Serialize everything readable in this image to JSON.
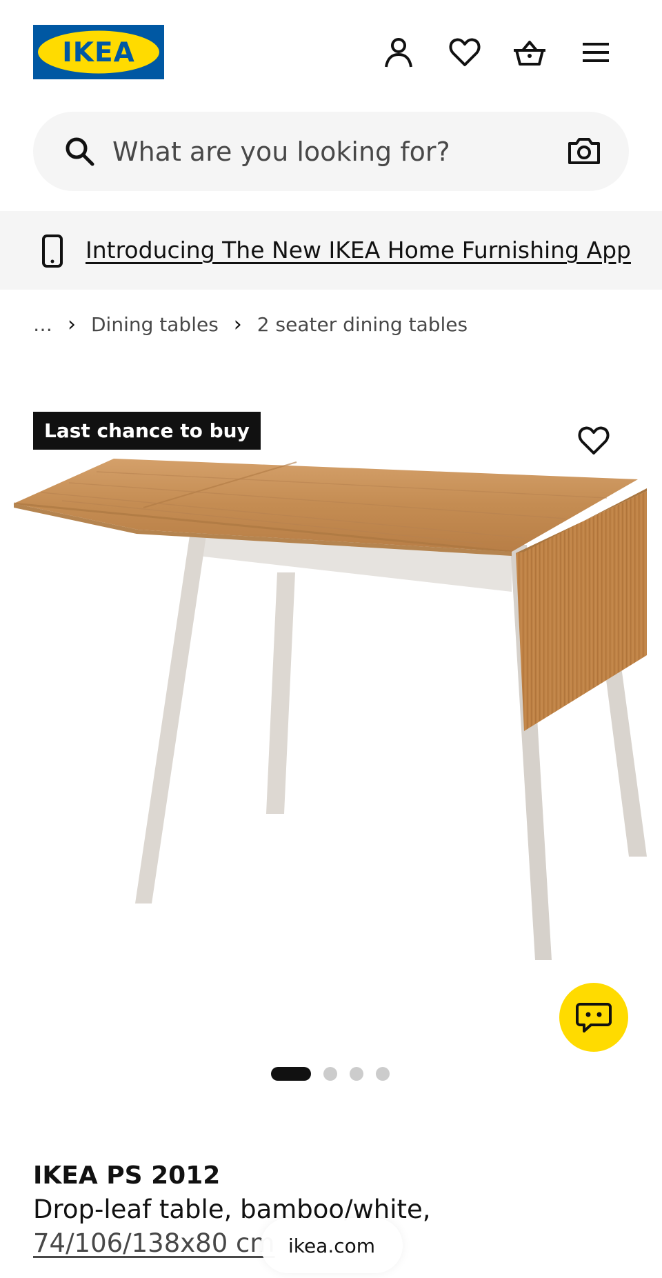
{
  "header": {
    "logo_text": "IKEA",
    "icons": [
      "account-icon",
      "favourites-icon",
      "basket-icon",
      "menu-icon"
    ]
  },
  "search": {
    "placeholder": "What are you looking for?",
    "icons": [
      "search-icon",
      "camera-icon"
    ]
  },
  "app_banner": {
    "link_text": "Introducing The New IKEA Home Furnishing App",
    "icon": "phone-icon"
  },
  "breadcrumb": {
    "ellipsis": "…",
    "items": [
      "Dining tables",
      "2 seater dining tables"
    ]
  },
  "product_image": {
    "badge": "Last chance to buy",
    "carousel": {
      "total": 4,
      "active": 1
    }
  },
  "product": {
    "name": "IKEA PS 2012",
    "description": "Drop-leaf table, bamboo/white,",
    "dimensions": "74/106/138x80 cm"
  },
  "browser": {
    "url": "ikea.com"
  },
  "colors": {
    "brand_blue": "#0058a3",
    "brand_yellow": "#ffdb00",
    "badge_bg": "#111111",
    "surface": "#f5f5f5"
  }
}
